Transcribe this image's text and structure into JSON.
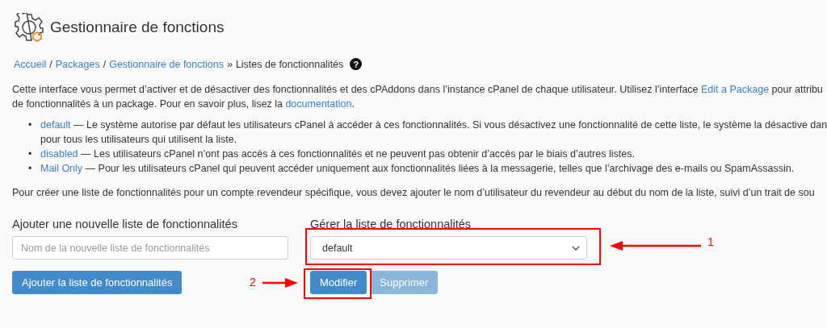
{
  "header": {
    "title": "Gestionnaire de fonctions"
  },
  "breadcrumb": {
    "links": [
      {
        "text": "Accueil",
        "sep": "/"
      },
      {
        "text": "Packages",
        "sep": "/"
      },
      {
        "text": "Gestionnaire de fonctions",
        "sep": "»"
      }
    ],
    "current": "Listes de fonctionnalités",
    "help": "?"
  },
  "bullet_marker": "•",
  "intro": [
    {
      "segments": [
        {
          "text": "Cette interface vous permet d’activer et de désactiver des fonctionnalités et des cPAddons dans l’instance cPanel de chaque utilisateur. Utilisez l’interface ",
          "link": false
        },
        {
          "text": "Edit a Package",
          "link": true
        },
        {
          "text": " pour attribu",
          "link": false
        }
      ]
    },
    {
      "segments": [
        {
          "text": "de fonctionnalités à un package. Pour en savoir plus, lisez la ",
          "link": false
        },
        {
          "text": "documentation",
          "link": true
        },
        {
          "text": ".",
          "link": false
        }
      ]
    }
  ],
  "bullets": [
    {
      "term": "default",
      "lines": [
        "— Le système autorise par défaut les utilisateurs cPanel à accéder à ces fonctionnalités. Si vous désactivez une fonctionnalité de cette liste, le système la désactive dan",
        "pour tous les utilisateurs qui utilisent la liste."
      ]
    },
    {
      "term": "disabled",
      "lines": [
        "— Les utilisateurs cPanel n’ont pas accès à ces fonctionnalités et ne peuvent pas obtenir d’accès par le biais d’autres listes."
      ]
    },
    {
      "term": "Mail Only",
      "lines": [
        "— Pour les utilisateurs cPanel qui peuvent accéder uniquement aux fonctionnalités liées à la messagerie, telles que l’archivage des e-mails ou SpamAssassin."
      ]
    }
  ],
  "note": "Pour créer une liste de fonctionnalités pour un compte revendeur spécifique, vous devez ajouter le nom d’utilisateur du revendeur au début du nom de la liste, suivi d’un trait de sou",
  "add_form": {
    "label": "Ajouter une nouvelle liste de fonctionnalités",
    "placeholder": "Nom de la nouvelle liste de fonctionnalités",
    "button": "Ajouter la liste de fonctionnalités"
  },
  "manage_form": {
    "label": "Gérer la liste de fonctionnalités",
    "value": "default",
    "buttons": [
      {
        "label": "Modifier",
        "disabled": false
      },
      {
        "label": "Supprimer",
        "disabled": true
      }
    ]
  },
  "annotations": [
    "1",
    "2"
  ]
}
